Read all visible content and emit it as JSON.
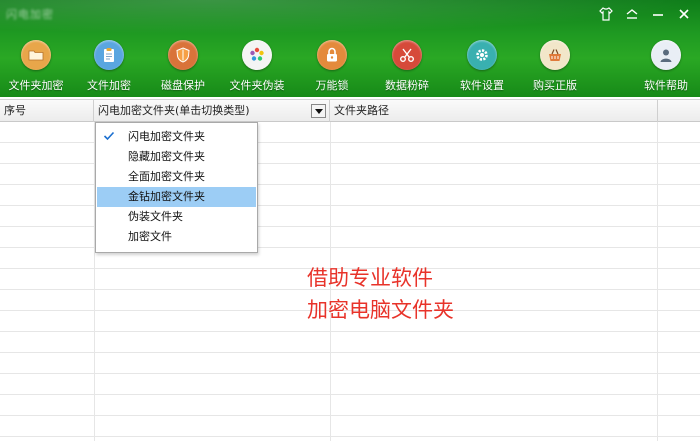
{
  "window": {
    "title": "闪电加密"
  },
  "toolbar": {
    "items": [
      {
        "label": "文件夹加密",
        "icon": "folder-icon",
        "color": "#e8a64a"
      },
      {
        "label": "文件加密",
        "icon": "clipboard-icon",
        "color": "#f0f0f0"
      },
      {
        "label": "磁盘保护",
        "icon": "shield-icon",
        "color": "#d9733a"
      },
      {
        "label": "文件夹伪装",
        "icon": "color-wheel-icon",
        "color": "#f4f4f4"
      },
      {
        "label": "万能锁",
        "icon": "padlock-icon",
        "color": "#e48a3c"
      },
      {
        "label": "数据粉碎",
        "icon": "scissors-icon",
        "color": "#d64a3a"
      },
      {
        "label": "软件设置",
        "icon": "gear-icon",
        "color": "#39b0b0"
      },
      {
        "label": "购买正版",
        "icon": "basket-icon",
        "color": "#f2e6c9"
      },
      {
        "label": "软件帮助",
        "icon": "user-icon",
        "color": "#e9eef5"
      }
    ]
  },
  "grid": {
    "columns": [
      "序号",
      "闪电加密文件夹(单击切换类型)",
      "文件夹路径"
    ]
  },
  "menu": {
    "items": [
      {
        "label": "闪电加密文件夹",
        "checked": true,
        "highlighted": false
      },
      {
        "label": "隐藏加密文件夹",
        "checked": false,
        "highlighted": false
      },
      {
        "label": "全面加密文件夹",
        "checked": false,
        "highlighted": false
      },
      {
        "label": "金钻加密文件夹",
        "checked": false,
        "highlighted": true
      },
      {
        "label": "伪装文件夹",
        "checked": false,
        "highlighted": false
      },
      {
        "label": "加密文件",
        "checked": false,
        "highlighted": false
      }
    ]
  },
  "caption": {
    "line1": "借助专业软件",
    "line2": "加密电脑文件夹"
  }
}
